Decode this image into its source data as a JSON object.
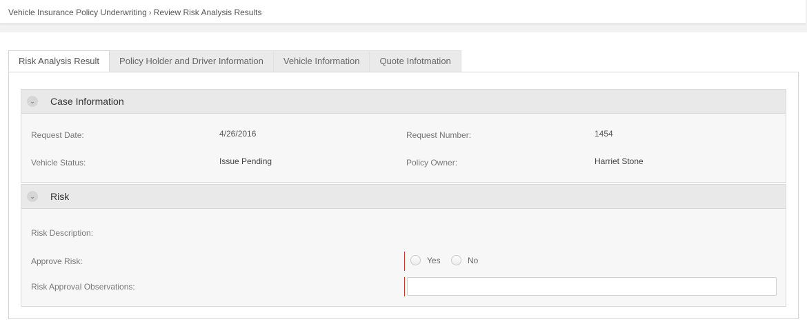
{
  "breadcrumb": {
    "parent": "Vehicle Insurance Policy Underwriting",
    "separator": "›",
    "current": "Review Risk Analysis Results"
  },
  "tabs": [
    {
      "label": "Risk Analysis Result",
      "active": true
    },
    {
      "label": "Policy Holder and Driver Information",
      "active": false
    },
    {
      "label": "Vehicle Information",
      "active": false
    },
    {
      "label": "Quote Infotmation",
      "active": false
    }
  ],
  "case_info": {
    "title": "Case Information",
    "request_date_label": "Request Date:",
    "request_date": "4/26/2016",
    "request_number_label": "Request Number:",
    "request_number": "1454",
    "vehicle_status_label": "Vehicle Status:",
    "vehicle_status": "Issue Pending",
    "policy_owner_label": "Policy Owner:",
    "policy_owner": "Harriet Stone"
  },
  "risk": {
    "title": "Risk",
    "description_label": "Risk Description:",
    "approve_label": "Approve Risk:",
    "yes_label": "Yes",
    "no_label": "No",
    "observations_label": "Risk Approval Observations:",
    "observations_value": ""
  },
  "icons": {
    "collapse": "chevron-down-icon"
  },
  "colors": {
    "required_marker": "#c0392b"
  }
}
